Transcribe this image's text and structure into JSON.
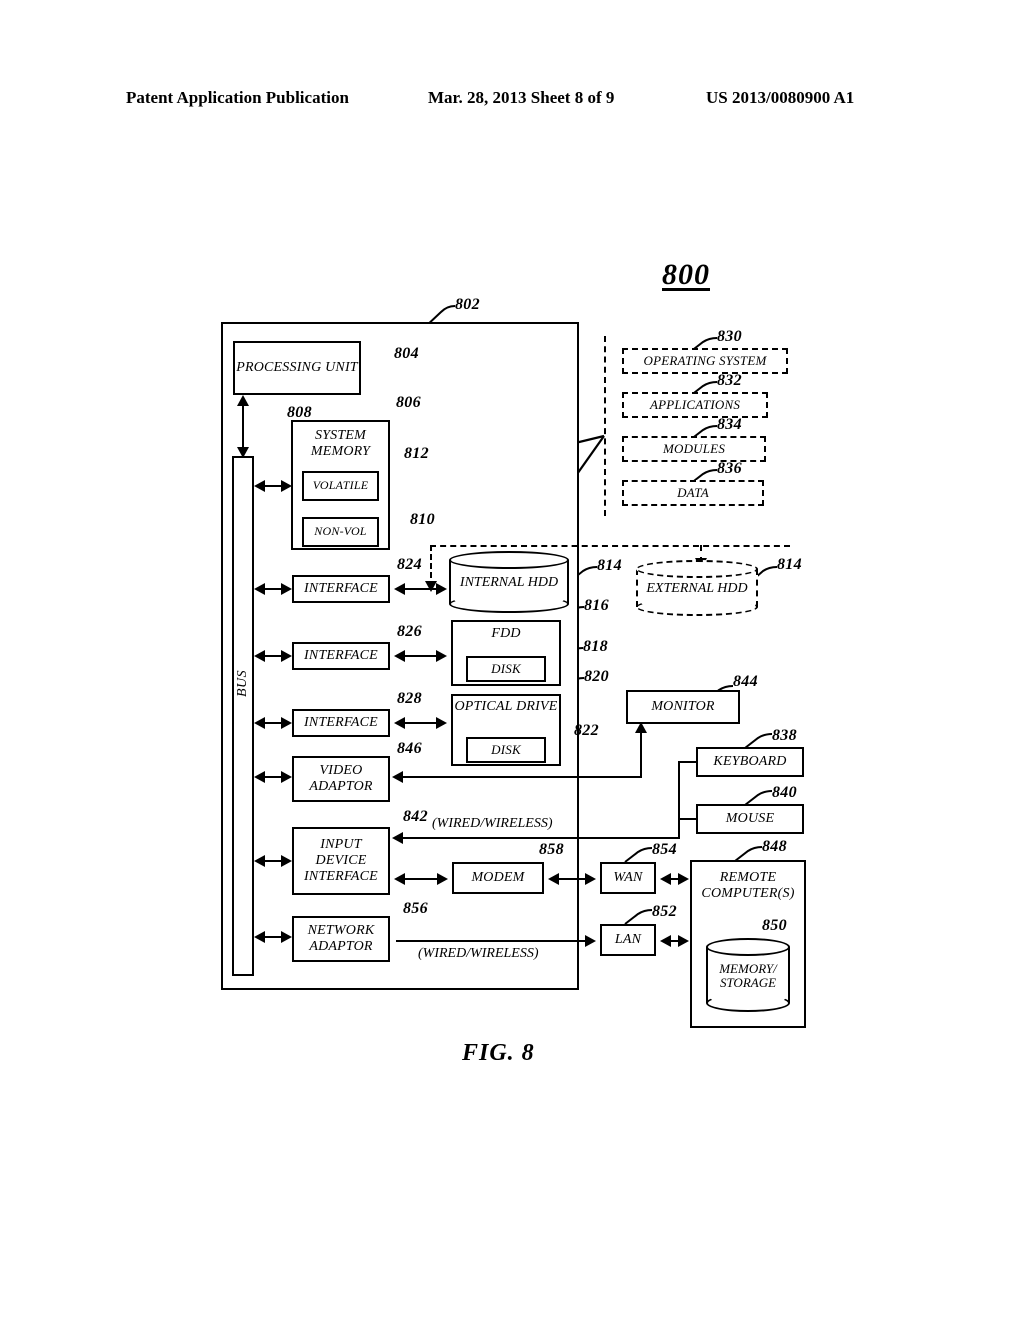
{
  "header": {
    "left": "Patent Application Publication",
    "middle": "Mar. 28, 2013  Sheet 8 of 9",
    "right": "US 2013/0080900 A1"
  },
  "figure": {
    "number": "800",
    "caption": "FIG. 8"
  },
  "blocks": {
    "processing_unit": "PROCESSING UNIT",
    "system_memory": "SYSTEM MEMORY",
    "volatile": "VOLATILE",
    "non_volatile": "NON-VOL",
    "bus": "BUS",
    "interface_hdd": "INTERFACE",
    "interface_fdd": "INTERFACE",
    "interface_optical": "INTERFACE",
    "video_adaptor": "VIDEO ADAPTOR",
    "input_device_interface": "INPUT DEVICE INTERFACE",
    "network_adaptor": "NETWORK ADAPTOR",
    "internal_hdd": "INTERNAL HDD",
    "external_hdd": "EXTERNAL HDD",
    "fdd": "FDD",
    "fdd_disk": "DISK",
    "optical_drive": "OPTICAL DRIVE",
    "optical_disk": "DISK",
    "monitor": "MONITOR",
    "keyboard": "KEYBOARD",
    "mouse": "MOUSE",
    "modem": "MODEM",
    "wan": "WAN",
    "lan": "LAN",
    "remote_computers": "REMOTE COMPUTER(S)",
    "memory_storage": "MEMORY/ STORAGE",
    "operating_system": "OPERATING SYSTEM",
    "applications": "APPLICATIONS",
    "modules": "MODULES",
    "data": "DATA"
  },
  "notes": {
    "wired_wireless_top": "(WIRED/WIRELESS)",
    "wired_wireless_bottom": "(WIRED/WIRELESS)"
  },
  "refs": {
    "r802": "802",
    "r804": "804",
    "r806": "806",
    "r808": "808",
    "r810": "810",
    "r812": "812",
    "r814_internal": "814",
    "r814_external": "814",
    "r816": "816",
    "r818": "818",
    "r820": "820",
    "r822": "822",
    "r824": "824",
    "r826": "826",
    "r828": "828",
    "r830": "830",
    "r832": "832",
    "r834": "834",
    "r836": "836",
    "r838": "838",
    "r840": "840",
    "r842": "842",
    "r844": "844",
    "r846": "846",
    "r848": "848",
    "r850": "850",
    "r852": "852",
    "r854": "854",
    "r856": "856",
    "r858": "858"
  }
}
